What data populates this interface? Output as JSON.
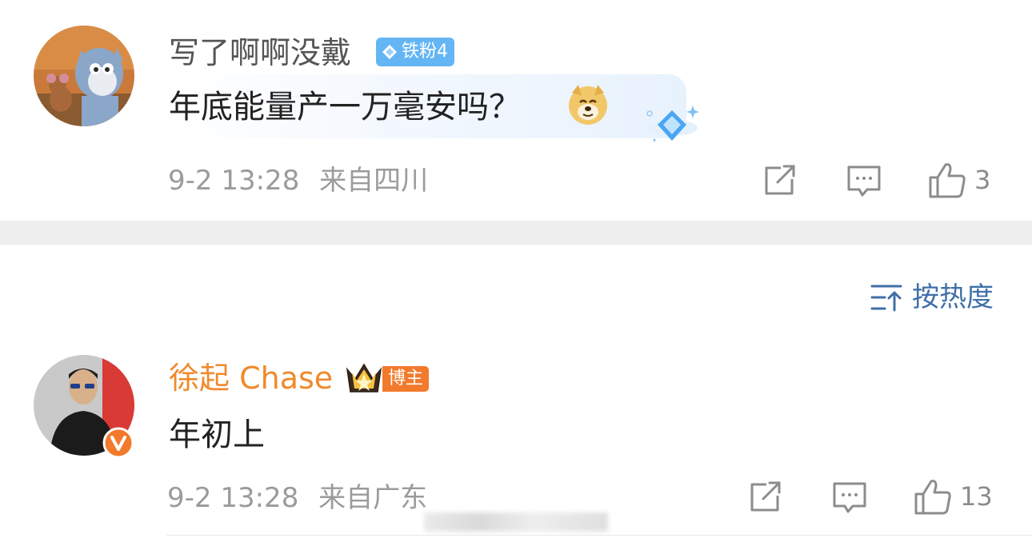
{
  "comments": [
    {
      "username": "写了啊啊没戴",
      "fan_badge": "铁粉4",
      "text": "年底能量产一万毫安吗？",
      "emoji_icon": "doge-icon",
      "time": "9-2 13:28",
      "location": "来自四川",
      "like_count": "3",
      "name_color": "#555555"
    },
    {
      "username": "徐起 Chase",
      "host_badge": "博主",
      "text": "年初上",
      "time": "9-2 13:28",
      "location": "来自广东",
      "like_count": "13",
      "name_color": "#f08a2c"
    }
  ],
  "sort": {
    "label": "按热度",
    "icon": "sort-icon"
  },
  "colors": {
    "accent_blue": "#3f6fa8",
    "host_orange": "#f27a2c",
    "fan_blue": "#64b5f4",
    "divider": "#eeeeee"
  }
}
